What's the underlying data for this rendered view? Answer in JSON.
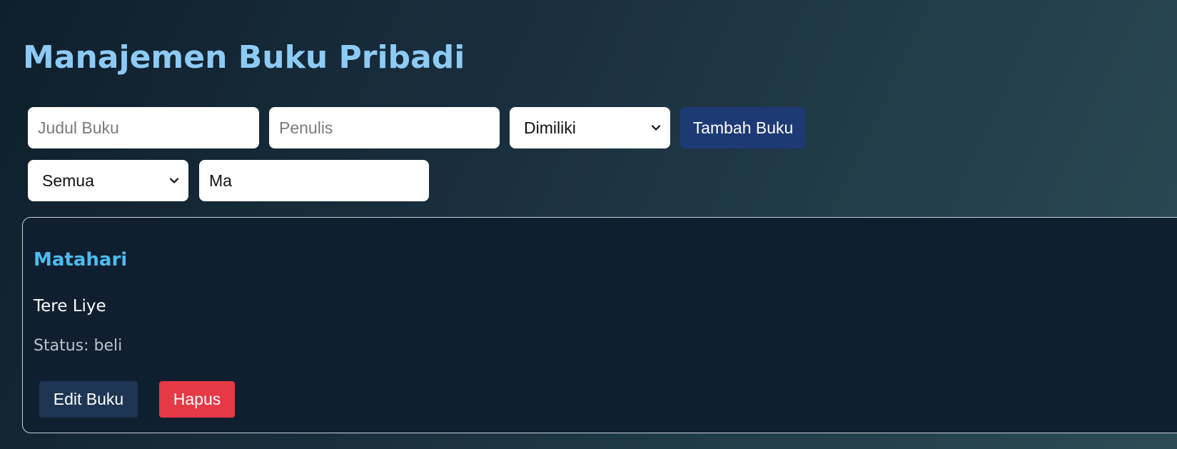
{
  "header": {
    "title": "Manajemen Buku Pribadi"
  },
  "add_form": {
    "title_placeholder": "Judul Buku",
    "author_placeholder": "Penulis",
    "status_select": "Dimiliki",
    "add_button": "Tambah Buku"
  },
  "filter": {
    "status_select": "Semua",
    "search_value": "Ma"
  },
  "books": [
    {
      "title": "Matahari",
      "author": "Tere Liye",
      "status": "Status: beli",
      "edit_label": "Edit Buku",
      "delete_label": "Hapus"
    }
  ],
  "icons": {
    "select_arrow": "chevron-down-icon"
  },
  "colors": {
    "title": "#8dcbf5",
    "book_title": "#4dbcf2",
    "add_button": "#1e3a74",
    "edit_button": "#1e3554",
    "delete_button": "#e63946"
  }
}
